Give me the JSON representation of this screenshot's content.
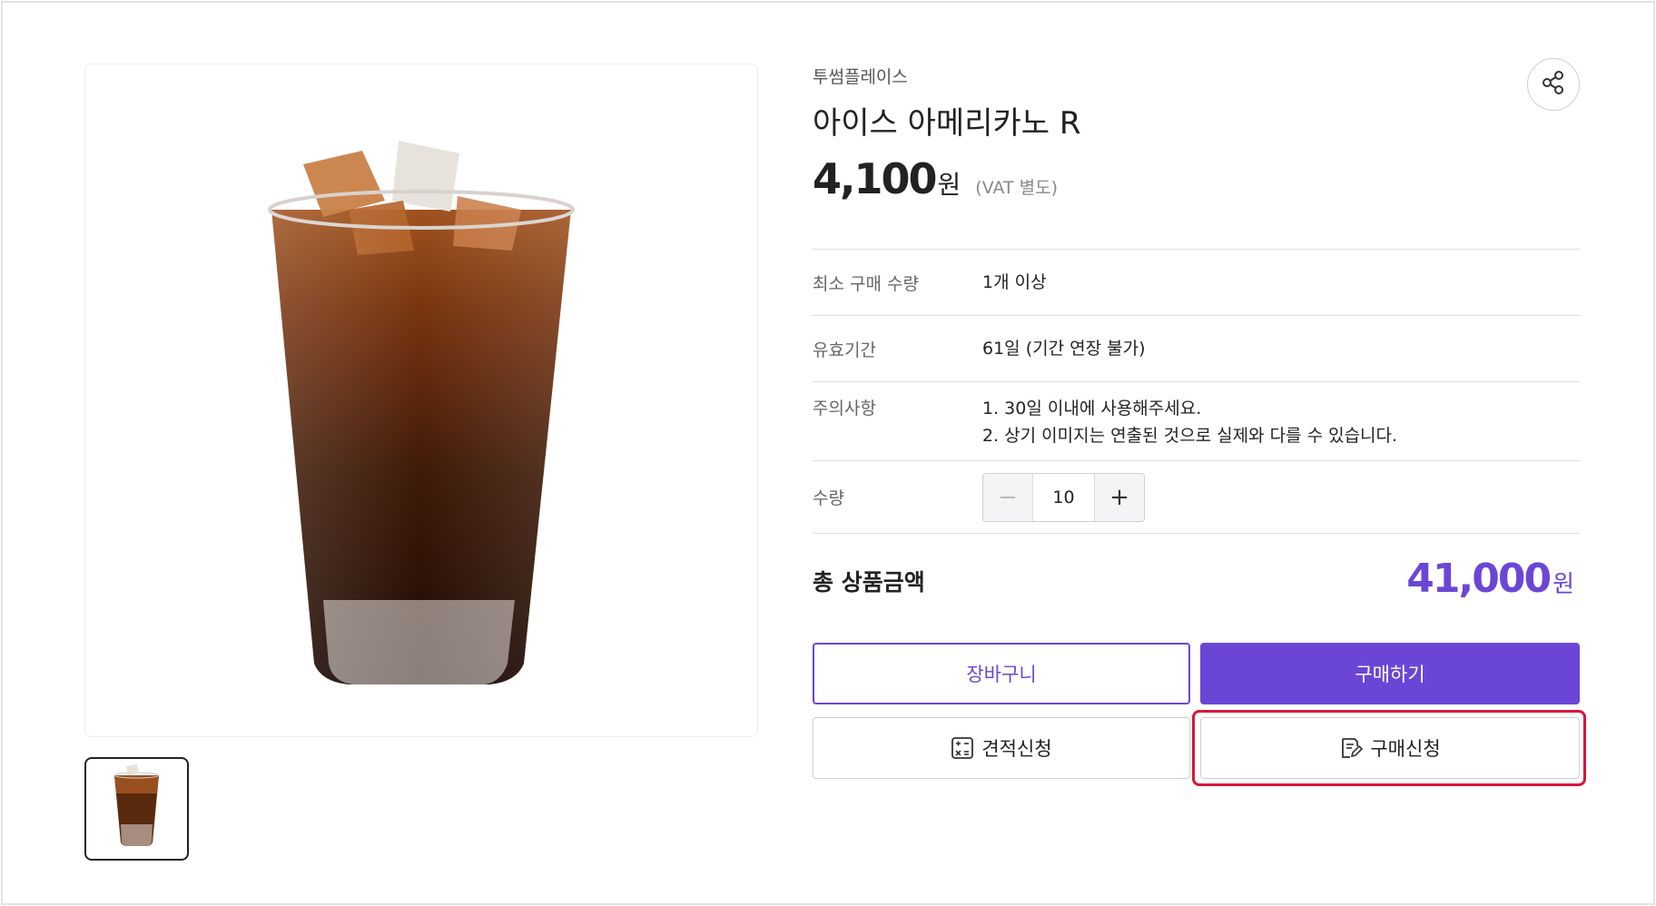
{
  "product": {
    "brand": "투썸플레이스",
    "name": "아이스 아메리카노 R",
    "price": "4,100",
    "price_unit": "원",
    "vat_note": "(VAT 별도)"
  },
  "info": {
    "min_qty_label": "최소 구매 수량",
    "min_qty_value": "1개 이상",
    "validity_label": "유효기간",
    "validity_value": "61일 (기간 연장 불가)",
    "notes_label": "주의사항",
    "note_1": "1. 30일 이내에 사용해주세요.",
    "note_2": "2. 상기 이미지는 연출된 것으로 실제와 다를 수 있습니다.",
    "qty_label": "수량",
    "qty_value": "10",
    "minus_symbol": "−",
    "plus_symbol": "+"
  },
  "total": {
    "label": "총 상품금액",
    "amount": "41,000",
    "unit": "원"
  },
  "buttons": {
    "cart": "장바구니",
    "buy": "구매하기",
    "quote": "견적신청",
    "purchase_request": "구매신청"
  },
  "icons": {
    "share": "share-icon",
    "quote": "calculator-icon",
    "purchase_request": "document-pen-icon"
  },
  "colors": {
    "accent": "#6b46d6",
    "highlight": "#d9163c"
  }
}
